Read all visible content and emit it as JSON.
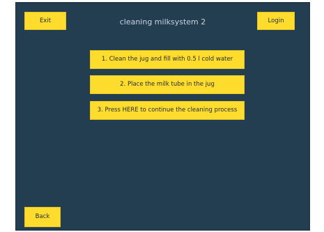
{
  "header": {
    "title": "cleaning milksystem 2",
    "exit_label": "Exit",
    "login_label": "Login"
  },
  "steps": [
    {
      "label": "1. Clean the jug and fill with 0.5 l cold water"
    },
    {
      "label": "2. Place the milk tube in the jug"
    },
    {
      "label": "3. Press HERE to continue the cleaning process"
    }
  ],
  "footer": {
    "back_label": "Back"
  },
  "colors": {
    "background": "#243e51",
    "button": "#fddc2e",
    "title_text": "#c9d3da"
  }
}
